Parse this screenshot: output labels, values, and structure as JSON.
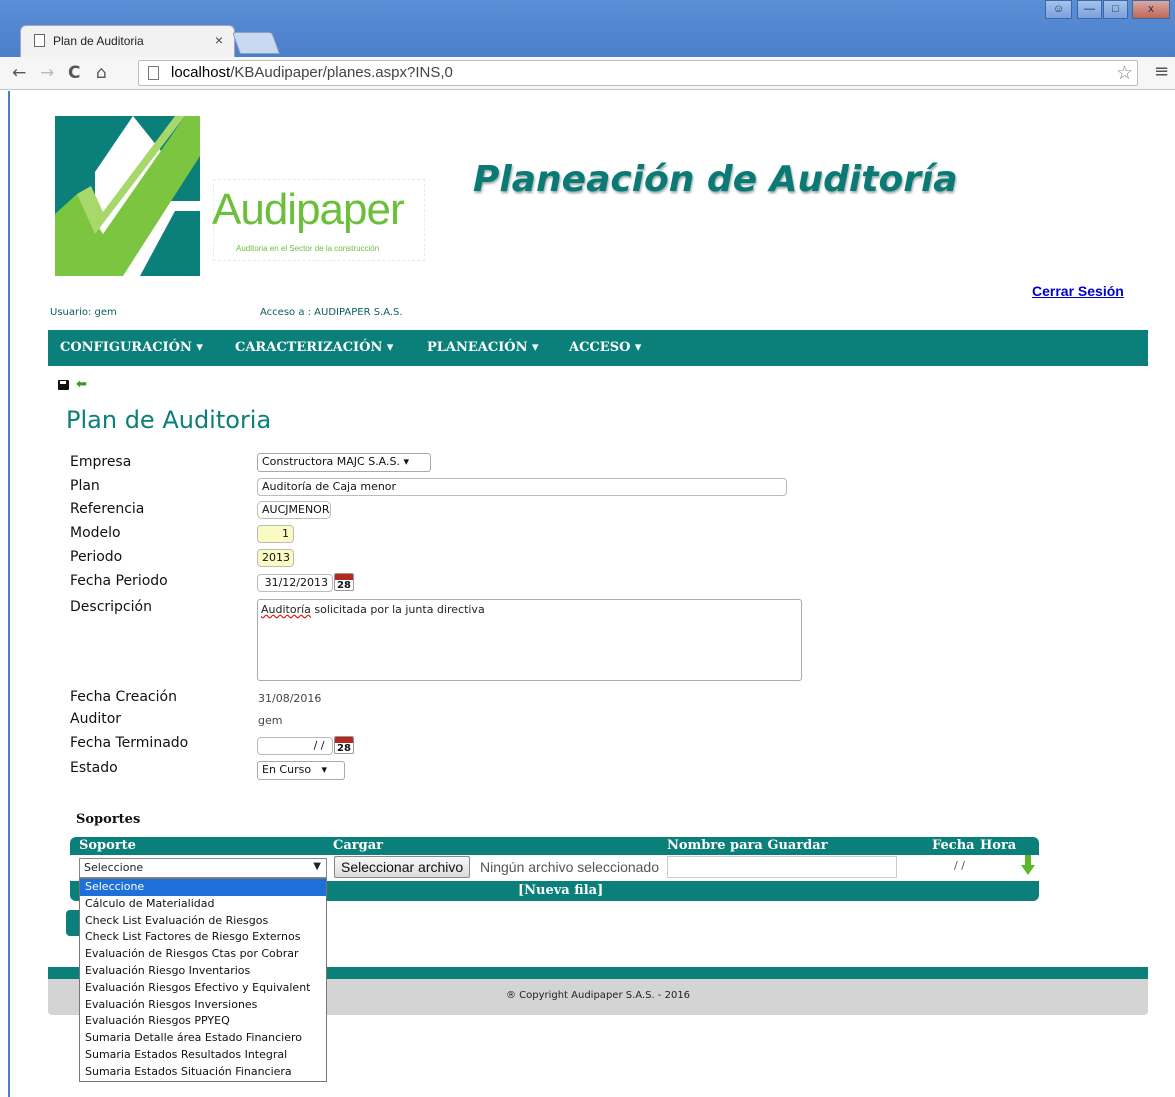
{
  "browser": {
    "tab_title": "Plan de Auditoria",
    "tab_close": "×",
    "url_host": "localhost",
    "url_path": "/KBAudipaper/planes.aspx?INS,0",
    "window_controls": [
      "minimize",
      "maximize",
      "close"
    ]
  },
  "header": {
    "logo_word": "Audipaper",
    "logo_tagline": "Auditoria en el Sector de la construcción",
    "title": "Planeación de Auditoría",
    "logout": "Cerrar Sesión",
    "user_label": "Usuario: gem",
    "access_label": "Acceso a : AUDIPAPER S.A.S."
  },
  "menu": [
    {
      "label": "CONFIGURACIÓN ▾"
    },
    {
      "label": "CARACTERIZACIÓN ▾"
    },
    {
      "label": "PLANEACIÓN ▾"
    },
    {
      "label": "ACCESO ▾"
    }
  ],
  "form": {
    "title": "Plan de Auditoria",
    "labels": {
      "empresa": "Empresa",
      "plan": "Plan",
      "referencia": "Referencia",
      "modelo": "Modelo",
      "periodo": "Periodo",
      "fecha_periodo": "Fecha Periodo",
      "descripcion": "Descripción",
      "fecha_creacion": "Fecha Creación",
      "auditor": "Auditor",
      "fecha_terminado": "Fecha Terminado",
      "estado": "Estado"
    },
    "values": {
      "empresa": "Constructora MAJC S.A.S.",
      "plan": "Auditoría de Caja menor",
      "referencia": "AUCJMENOR",
      "modelo": "1",
      "periodo": "2013",
      "fecha_periodo": "31/12/2013",
      "descripcion_word1": "Auditoría",
      "descripcion_rest": " solicitada por la junta directiva",
      "fecha_creacion": "31/08/2016",
      "auditor": "gem",
      "fecha_terminado": " / / ",
      "estado": "En Curso"
    },
    "calendar_day": "28"
  },
  "soportes": {
    "title": "Soportes",
    "headers": {
      "soporte": "Soporte",
      "cargar": "Cargar",
      "nombre": "Nombre para Guardar",
      "fecha": "Fecha",
      "hora": "Hora"
    },
    "select_value": "Seleccione",
    "file_button": "Seleccionar archivo",
    "file_status": "Ningún archivo seleccionado",
    "date_value": "/ /",
    "new_row": "[Nueva fila]",
    "options": [
      "Seleccione",
      "Cálculo de Materialidad",
      "Check List Evaluación de Riesgos",
      "Check List Factores de Riesgo Externos",
      "Evaluación de Riesgos Ctas por Cobrar",
      "Evaluación Riesgo Inventarios",
      "Evaluación Riesgos Efectivo y Equivalent",
      "Evaluación Riesgos Inversiones",
      "Evaluación Riesgos PPYEQ",
      "Sumaria Detalle área Estado Financiero",
      "Sumaria Estados Resultados Integral",
      "Sumaria Estados Situación Financiera"
    ]
  },
  "footer": {
    "copyright": "® Copyright Audipaper S.A.S. - 2016"
  },
  "colors": {
    "brand_teal": "#0b7f79",
    "brand_green": "#6bbf3a",
    "chrome_blue": "#4a7ec9",
    "highlight": "#1e6fd9"
  }
}
